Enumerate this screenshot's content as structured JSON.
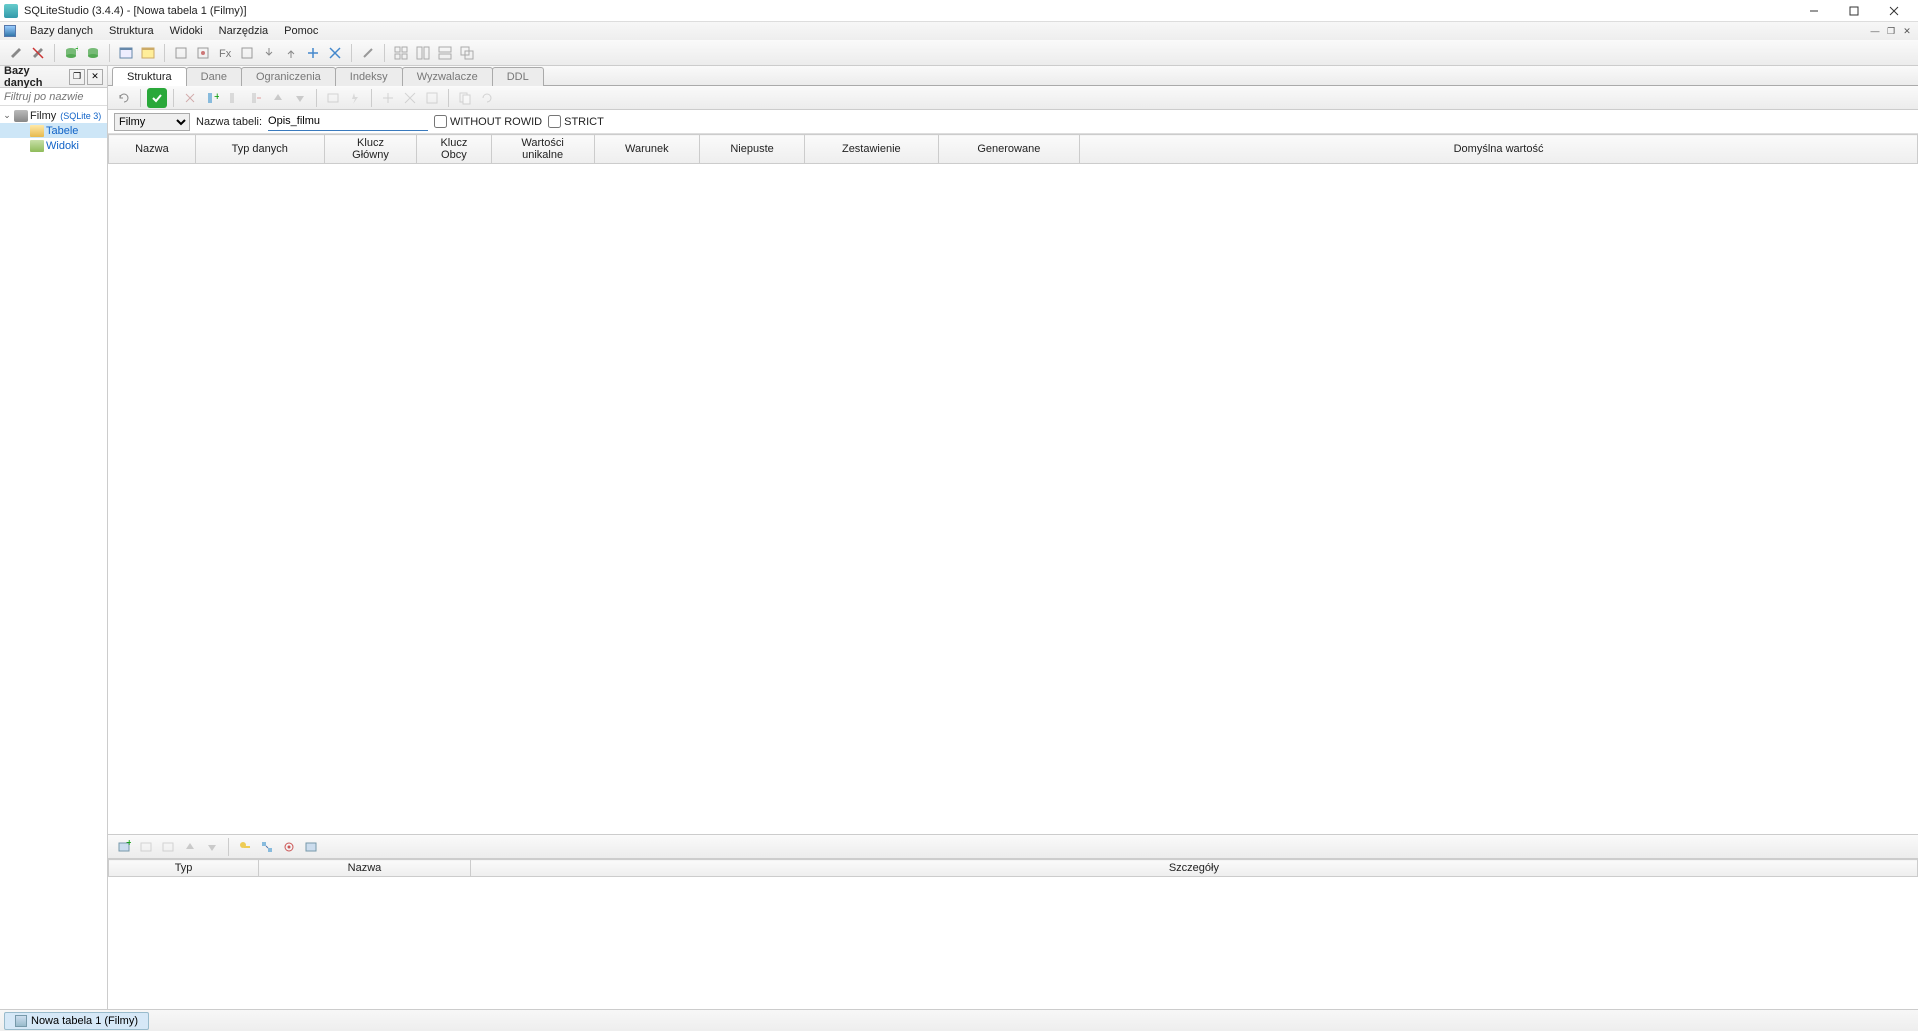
{
  "window": {
    "title": "SQLiteStudio (3.4.4) - [Nowa tabela 1 (Filmy)]"
  },
  "menubar": {
    "db": "Bazy danych",
    "struct": "Struktura",
    "views": "Widoki",
    "tools": "Narzędzia",
    "help": "Pomoc"
  },
  "sidebar": {
    "title": "Bazy danych",
    "filter_placeholder": "Filtruj po nazwie",
    "db_name": "Filmy",
    "db_engine": "(SQLite 3)",
    "tables": "Tabele",
    "views": "Widoki"
  },
  "tabs": {
    "struktura": "Struktura",
    "dane": "Dane",
    "ograniczenia": "Ograniczenia",
    "indeksy": "Indeksy",
    "wyzwalacze": "Wyzwalacze",
    "ddl": "DDL"
  },
  "form": {
    "db_selected": "Filmy",
    "table_label": "Nazwa tabeli:",
    "table_name": "Opis_filmu",
    "without_rowid": "WITHOUT ROWID",
    "strict": "STRICT"
  },
  "columns_header": {
    "nazwa": "Nazwa",
    "typ": "Typ danych",
    "klucz_glowny_1": "Klucz",
    "klucz_glowny_2": "Główny",
    "klucz_obcy_1": "Klucz",
    "klucz_obcy_2": "Obcy",
    "unikalne_1": "Wartości",
    "unikalne_2": "unikalne",
    "warunek": "Warunek",
    "niepuste": "Niepuste",
    "zestawienie": "Zestawienie",
    "generowane": "Generowane",
    "domyslna": "Domyślna wartość"
  },
  "constraints_header": {
    "typ": "Typ",
    "nazwa": "Nazwa",
    "szczegoly": "Szczegóły"
  },
  "statusbar": {
    "doc": "Nowa tabela 1 (Filmy)"
  }
}
